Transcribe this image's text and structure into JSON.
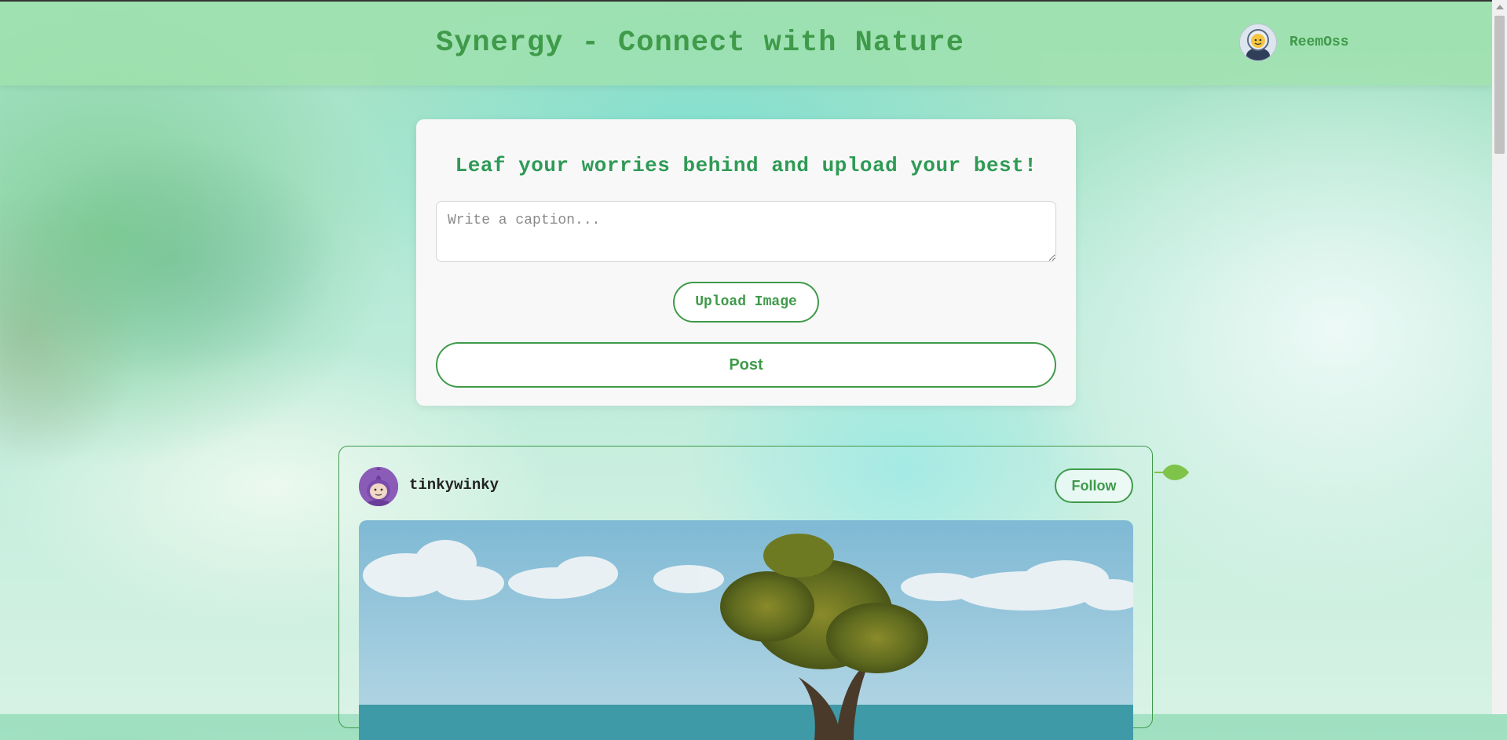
{
  "header": {
    "title": "Synergy - Connect with Nature",
    "user": {
      "name": "ReemOss",
      "avatar_icon": "astronaut-avatar-icon"
    }
  },
  "composer": {
    "title": "Leaf your worries behind and upload your best!",
    "caption_placeholder": "Write a caption...",
    "caption_value": "",
    "upload_label": "Upload Image",
    "post_label": "Post"
  },
  "feed": {
    "posts": [
      {
        "username": "tinkywinky",
        "avatar_icon": "purple-character-avatar-icon",
        "follow_label": "Follow",
        "image": "tree-by-the-sea-photo"
      }
    ]
  },
  "colors": {
    "accent": "#3f9a4a",
    "title_green": "#2e9a55",
    "card_bg": "#f8f8f8",
    "header_bg": "#a0e1aa"
  }
}
